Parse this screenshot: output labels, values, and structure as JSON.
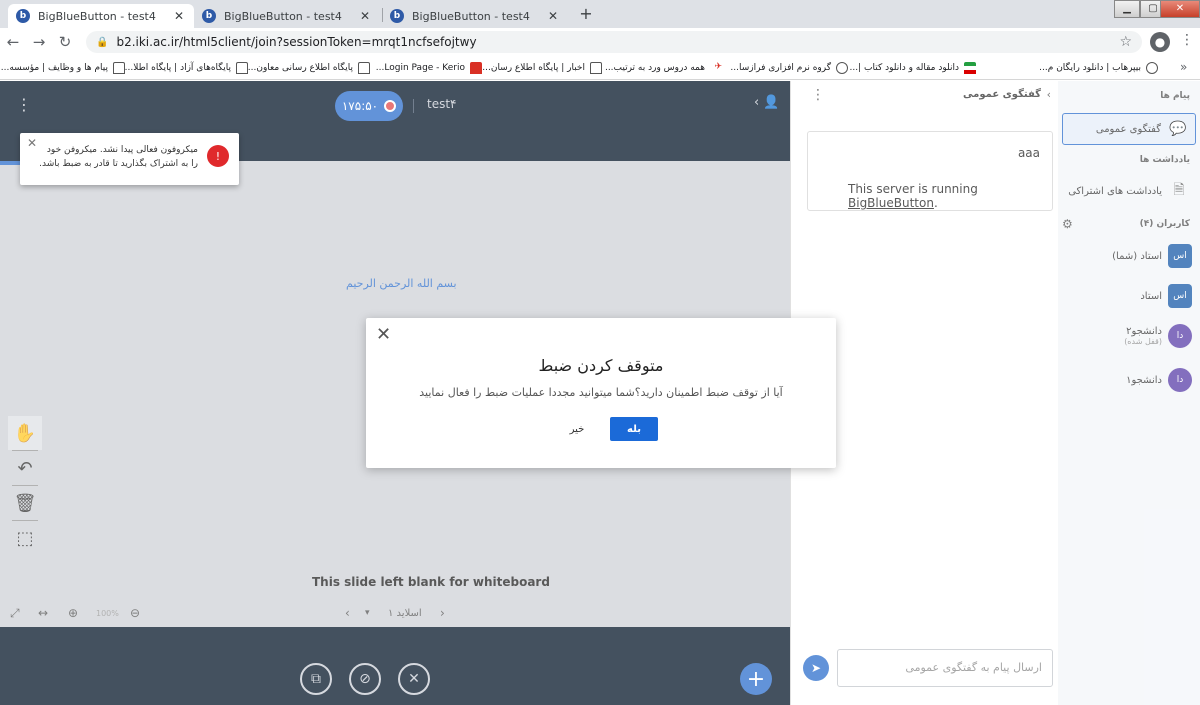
{
  "browser": {
    "tabs": [
      {
        "title": "BigBlueButton - test4"
      },
      {
        "title": "BigBlueButton - test4"
      },
      {
        "title": "BigBlueButton - test4"
      }
    ],
    "url": "b2.iki.ac.ir/html5client/join?sessionToken=mrqt1ncfsefojtwy",
    "bookmarks": [
      {
        "label": "بیپرهاب | دانلود رایگان م...",
        "icon": "globe-icon"
      },
      {
        "label": "دانلود مقاله و دانلود کتاب |...",
        "icon": "flag-icon"
      },
      {
        "label": "گروه نرم افزاری فرازسا...",
        "icon": "globe-icon"
      },
      {
        "label": "همه دروس ورد به ترتیب...",
        "icon": "globe-icon"
      },
      {
        "label": "اخبار | پایگاه اطلاع رسان...",
        "icon": "page-icon"
      },
      {
        "label": "Login Page - Kerio...",
        "icon": "shield-icon"
      },
      {
        "label": "پایگاه اطلاع رسانی معاون...",
        "icon": "page-icon"
      },
      {
        "label": "پایگاه‌های آزاد | پایگاه اطلا...",
        "icon": "page-icon"
      },
      {
        "label": "پیام ها و وظایف | مؤسسه...",
        "icon": "page-icon"
      }
    ]
  },
  "presentation": {
    "recording_time": "۱۷۵:۵۰",
    "meeting_name": "test۴",
    "basmala": "بسم الله الرحمن الرحیم",
    "blank_text": "This slide left blank for whiteboard",
    "slide_label": "اسلاید ۱",
    "zoom": "100%"
  },
  "toast": {
    "text": "میکروفون فعالی پیدا نشد. میکروفن خود را به اشتراک بگذارید تا قادر به ضبط باشد."
  },
  "modal": {
    "title": "متوقف کردن ضبط",
    "description": "آیا از توقف ضبط اطمینان دارید؟شما میتوانید مجددا عملیات ضبط را فعال نمایید",
    "yes": "بله",
    "no": "خیر"
  },
  "chat": {
    "title": "گفتگوی عمومی",
    "messages": {
      "first": "aaa",
      "server_prefix": "This server is running ",
      "server_link": "BigBlueButton",
      "server_suffix": "."
    },
    "input_placeholder": "ارسال پیام به گفتگوی عمومی"
  },
  "userlist": {
    "messages_title": "پیام ها",
    "public_chat": "گفتگوی عمومی",
    "notes_title": "یادداشت ها",
    "shared_notes": "یادداشت های اشتراکی",
    "users_title": "کاربران (۴)",
    "users": [
      {
        "initials": "اس",
        "name": "استاد (شما)",
        "sub": "",
        "color": "#1a5ba8"
      },
      {
        "initials": "اس",
        "name": "استاد",
        "sub": "",
        "color": "#1a5ba8"
      },
      {
        "initials": "دا",
        "name": "دانشجو۲",
        "sub": "(قفل شده)",
        "color": "#5a3fa8"
      },
      {
        "initials": "دا",
        "name": "دانشجو۱",
        "sub": "",
        "color": "#5a3fa8"
      }
    ]
  }
}
